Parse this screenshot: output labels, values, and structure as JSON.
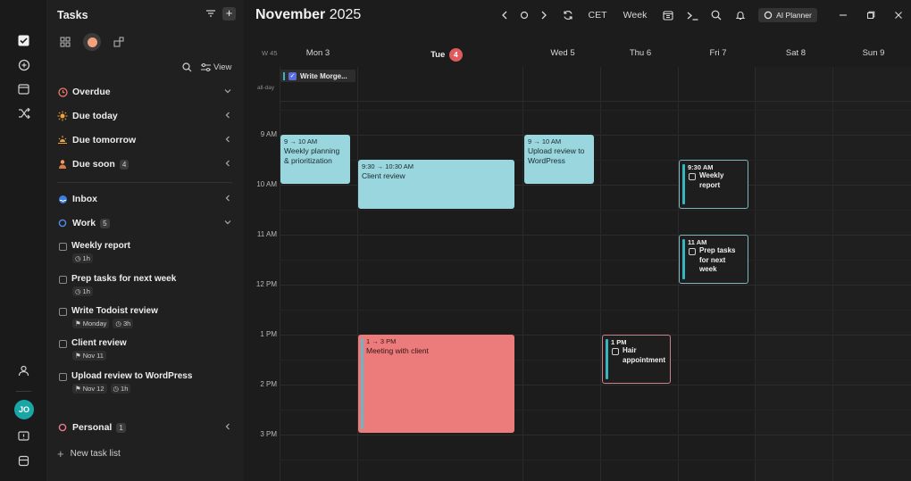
{
  "app": {
    "title": "Tasks"
  },
  "panel": {
    "title": "Tasks",
    "view_label": "View",
    "sections": [
      {
        "label": "Overdue",
        "icon": "overdue-icon"
      },
      {
        "label": "Due today",
        "icon": "sun-icon"
      },
      {
        "label": "Due tomorrow",
        "icon": "sunrise-icon"
      },
      {
        "label": "Due soon",
        "icon": "person-icon",
        "count": "4"
      },
      {
        "label": "Inbox",
        "icon": "inbox-icon"
      },
      {
        "label": "Work",
        "icon": "circle-icon",
        "count": "5"
      },
      {
        "label": "Personal",
        "icon": "circle-icon",
        "count": "1"
      }
    ],
    "tasks": [
      {
        "title": "Weekly report",
        "chips": [
          "1h"
        ]
      },
      {
        "title": "Prep tasks for next week",
        "chips": [
          "1h"
        ]
      },
      {
        "title": "Write Todoist review",
        "chips": [
          "Monday",
          "3h"
        ]
      },
      {
        "title": "Client review",
        "chips": [
          "Nov 11"
        ]
      },
      {
        "title": "Upload review to WordPress",
        "chips": [
          "Nov 12",
          "1h"
        ]
      }
    ],
    "new_list": "New task list"
  },
  "rail": {
    "avatar": "JO"
  },
  "calendar": {
    "month": "November",
    "year": "2025",
    "timezone": "CET",
    "view": "Week",
    "ai_planner": "AI Planner",
    "week_label": "W 45",
    "allday_label": "all-day",
    "days": [
      {
        "name": "Mon 3"
      },
      {
        "name": "Tue",
        "badge": "4"
      },
      {
        "name": "Wed 5"
      },
      {
        "name": "Thu 6"
      },
      {
        "name": "Fri 7"
      },
      {
        "name": "Sat 8"
      },
      {
        "name": "Sun 9"
      }
    ],
    "times": [
      "9 AM",
      "10 AM",
      "11 AM",
      "12 PM",
      "1 PM",
      "2 PM",
      "3 PM"
    ],
    "allday_event": "Write Morge...",
    "events": [
      {
        "time": "9 → 10 AM",
        "title": "Weekly planning & prioritization"
      },
      {
        "time": "9:30 → 10:30 AM",
        "title": "Client review"
      },
      {
        "time": "9 → 10 AM",
        "title": "Upload review to WordPress"
      },
      {
        "time": "1 → 3 PM",
        "title": "Meeting with client"
      }
    ],
    "task_blocks": [
      {
        "time": "9:30 AM",
        "title": "Weekly report"
      },
      {
        "time": "11 AM",
        "title": "Prep tasks for next week"
      },
      {
        "time": "1 PM",
        "title": "Hair appointment"
      }
    ]
  },
  "colors": {
    "accent_teal": "#9ad6de",
    "accent_red": "#ec7b7b",
    "badge": "#e05b5b",
    "avatar": "#1aa6a6"
  }
}
